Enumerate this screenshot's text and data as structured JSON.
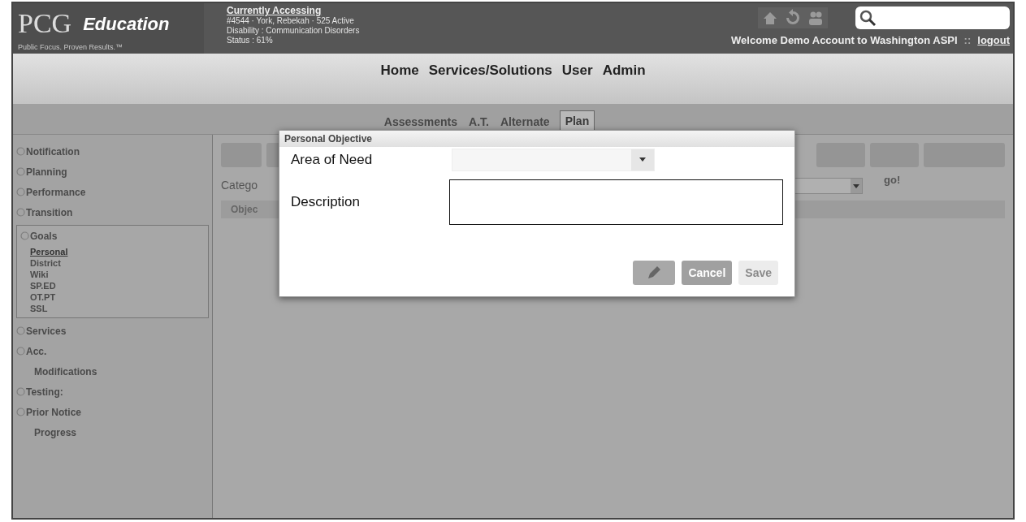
{
  "header": {
    "logo": {
      "mark": "PCG",
      "name": "Education",
      "tagline": "Public Focus. Proven Results.™"
    },
    "accessing": {
      "heading": "Currently Accessing",
      "lines": [
        "#4544 · York, Rebekah · 525 Active",
        "Disability : Communication Disorders",
        "Status : 61%"
      ]
    },
    "welcome": "Welcome Demo Account to Washington ASPI",
    "separator": "::",
    "logout": "logout"
  },
  "nav": [
    {
      "label": "Home"
    },
    {
      "label": "Services/Solutions"
    },
    {
      "label": "User"
    },
    {
      "label": "Admin"
    }
  ],
  "tabs": [
    {
      "label": "Assessments",
      "selected": false
    },
    {
      "label": "A.T.",
      "selected": false
    },
    {
      "label": "Alternate",
      "selected": false
    },
    {
      "label": "Plan",
      "selected": true
    }
  ],
  "sidebar": {
    "items": [
      {
        "label": "Notification",
        "kind": "section",
        "expanded": false
      },
      {
        "label": "Planning",
        "kind": "section",
        "expanded": false
      },
      {
        "label": "Performance",
        "kind": "section",
        "expanded": false
      },
      {
        "label": "Transition",
        "kind": "section",
        "expanded": false
      },
      {
        "label": "Goals",
        "kind": "section",
        "expanded": true,
        "children": [
          {
            "label": "Personal",
            "selected": true
          },
          {
            "label": "District",
            "selected": false
          },
          {
            "label": "Wiki",
            "selected": false
          },
          {
            "label": "SP.ED",
            "selected": false
          },
          {
            "label": "OT.PT",
            "selected": false
          },
          {
            "label": "SSL",
            "selected": false
          }
        ]
      },
      {
        "label": "Services",
        "kind": "section",
        "expanded": false
      },
      {
        "label": "Acc.",
        "kind": "section",
        "expanded": false
      },
      {
        "label": "Modifications",
        "kind": "sub"
      },
      {
        "label": "Testing:",
        "kind": "section",
        "expanded": false
      },
      {
        "label": "Prior Notice",
        "kind": "section",
        "expanded": false
      },
      {
        "label": "Progress",
        "kind": "sub"
      }
    ]
  },
  "content": {
    "category_label": "Catego",
    "go": "go!",
    "column_1": "Objec"
  },
  "dialog": {
    "title": "Personal Objective",
    "fields": [
      {
        "label": "Area of Need",
        "kind": "select"
      },
      {
        "label": "Description",
        "kind": "textarea"
      }
    ],
    "buttons": [
      {
        "kind": "icon",
        "disabled": false
      },
      {
        "kind": "text",
        "label": "Cancel",
        "disabled": false
      },
      {
        "kind": "text",
        "label": "Save",
        "disabled": true
      }
    ]
  }
}
